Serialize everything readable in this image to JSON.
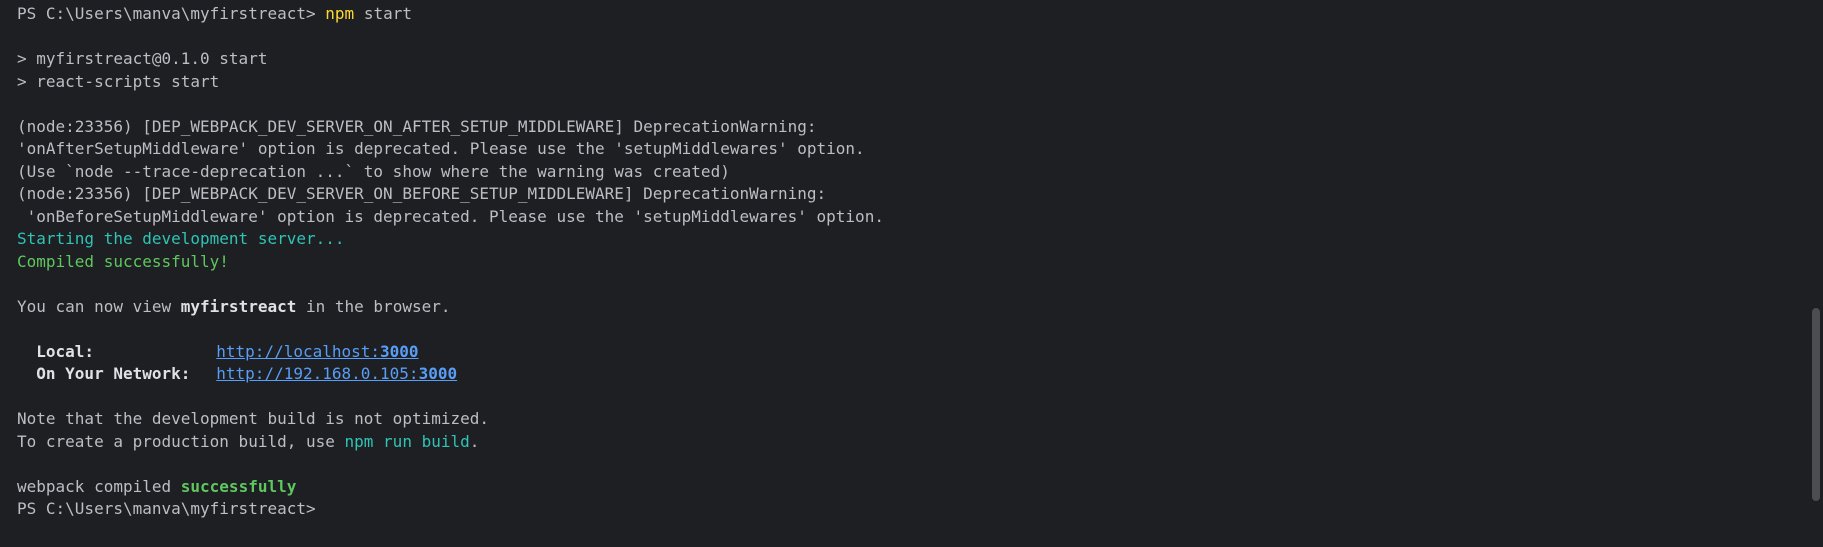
{
  "terminal": {
    "prompt_path": "PS C:\\Users\\manva\\myfirstreact>",
    "command_name": "npm",
    "command_args": "start",
    "script_line1": "> myfirstreact@0.1.0 start",
    "script_line2": "> react-scripts start",
    "warn1_line1": "(node:23356) [DEP_WEBPACK_DEV_SERVER_ON_AFTER_SETUP_MIDDLEWARE] DeprecationWarning:",
    "warn1_line2": "'onAfterSetupMiddleware' option is deprecated. Please use the 'setupMiddlewares' option.",
    "warn1_line3": "(Use `node --trace-deprecation ...` to show where the warning was created)",
    "warn2_line1": "(node:23356) [DEP_WEBPACK_DEV_SERVER_ON_BEFORE_SETUP_MIDDLEWARE] DeprecationWarning:",
    "warn2_line2": " 'onBeforeSetupMiddleware' option is deprecated. Please use the 'setupMiddlewares' option.",
    "starting": "Starting the development server...",
    "compiled": "Compiled successfully!",
    "view_prefix": "You can now view ",
    "app_name": "myfirstreact",
    "view_suffix": " in the browser.",
    "local_label": "Local:",
    "local_url_base": "http://localhost:",
    "local_url_port": "3000",
    "network_label": "On Your Network:",
    "network_url_base": "http://192.168.0.105:",
    "network_url_port": "3000",
    "note_line": "Note that the development build is not optimized.",
    "build_prefix": "To create a production build, use ",
    "build_cmd": "npm run build",
    "build_suffix": ".",
    "webpack_prefix": "webpack compiled ",
    "webpack_status": "successfully",
    "final_prompt": "PS C:\\Users\\manva\\myfirstreact>"
  },
  "colors": {
    "background": "#1e1f22",
    "text": "#bcbec4",
    "command": "#fdd835",
    "cyan": "#2ec4b6",
    "green": "#5fc75f",
    "link": "#589df6"
  }
}
